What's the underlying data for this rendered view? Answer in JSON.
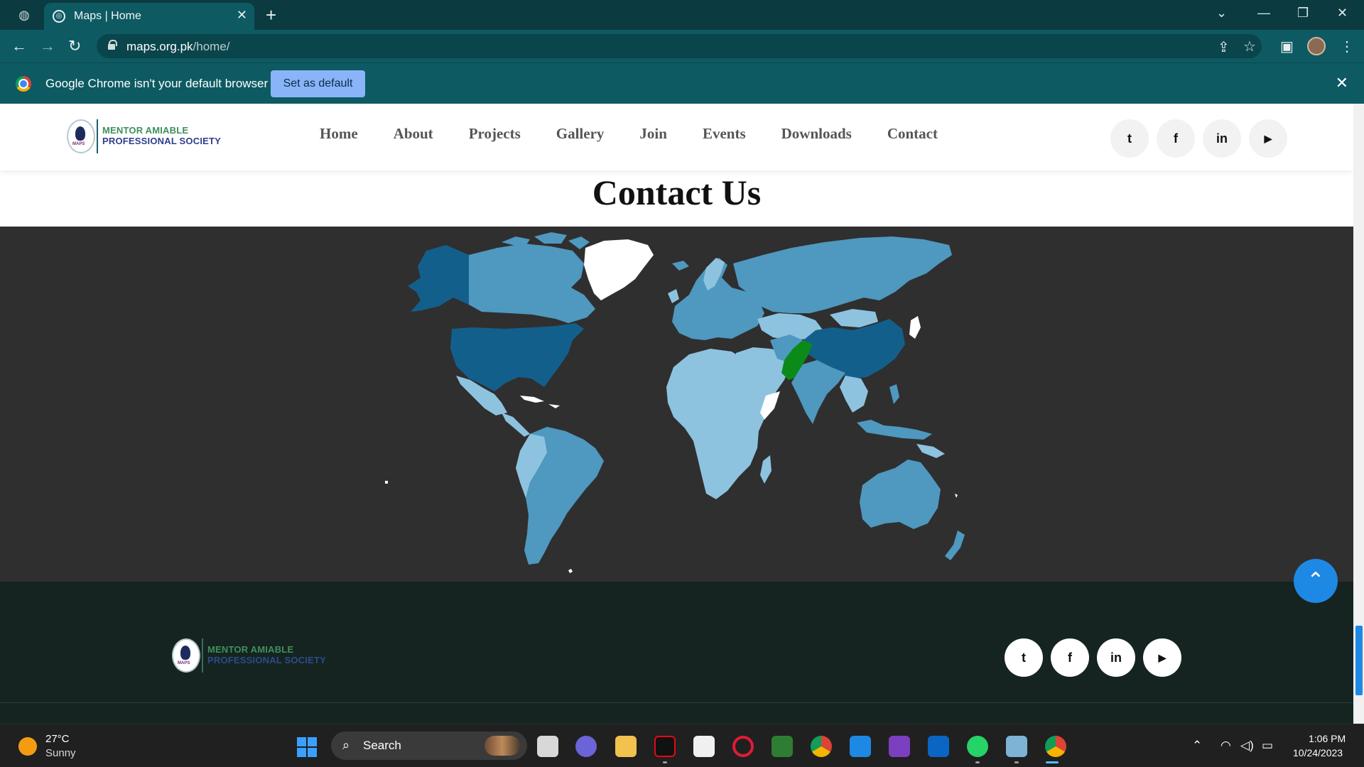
{
  "browser": {
    "tab_title": "Maps | Home",
    "new_tab": "+",
    "url_host": "maps.org.pk",
    "url_path": "/home/",
    "infobar_text": "Google Chrome isn't your default browser",
    "infobar_button": "Set as default"
  },
  "site": {
    "logo_line1": "MENTOR AMIABLE",
    "logo_line2": "PROFESSIONAL SOCIETY",
    "logo_mark": "MAPS",
    "nav": [
      "Home",
      "About",
      "Projects",
      "Gallery",
      "Join",
      "Events",
      "Downloads",
      "Contact"
    ],
    "social": [
      "twitter-icon",
      "facebook-icon",
      "linkedin-icon",
      "youtube-icon"
    ],
    "social_glyphs": [
      "t",
      "f",
      "in",
      "▶"
    ],
    "section_title": "Contact Us",
    "map_colors": {
      "background": "#2f2f2f",
      "country_light": "#8ec3df",
      "country_mid": "#4f98bf",
      "country_dark": "#135f8c",
      "highlight_pakistan": "#0b8a1a",
      "unshaded": "#ffffff"
    },
    "footer_logo_line1": "MENTOR AMIABLE",
    "footer_logo_line2": "PROFESSIONAL SOCIETY",
    "back_to_top": "⌃"
  },
  "taskbar": {
    "temperature": "27°C",
    "condition": "Sunny",
    "search_label": "Search",
    "time": "1:06 PM",
    "date": "10/24/2023"
  }
}
